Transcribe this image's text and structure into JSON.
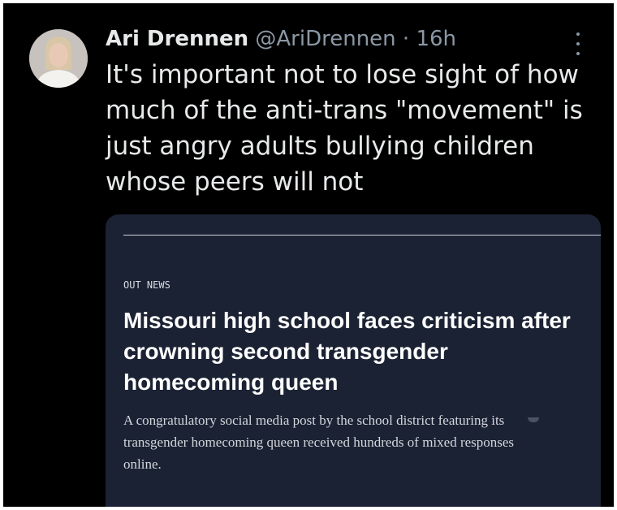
{
  "tweet": {
    "author_name": "Ari Drennen",
    "author_handle": "@AriDrennen",
    "separator": "·",
    "timestamp": "16h",
    "text_lines": [
      "It's important not to lose sight of how",
      "much of the anti-trans \"movement\" is",
      "just angry adults bullying children",
      "whose peers will not"
    ]
  },
  "card": {
    "kicker": "OUT NEWS",
    "headline_lines": [
      "Missouri high school faces criticism after",
      "crowning second transgender",
      "homecoming queen"
    ],
    "dek_lines": [
      "A congratulatory social media post by the school district featuring its",
      "transgender homecoming queen received hundreds of mixed responses",
      "online."
    ]
  },
  "icons": {
    "more": "more-options-icon",
    "avatar": "avatar"
  },
  "colors": {
    "background": "#000000",
    "text": "#e7e9ea",
    "muted": "#8b98a5",
    "card_background": "#1b2233"
  }
}
